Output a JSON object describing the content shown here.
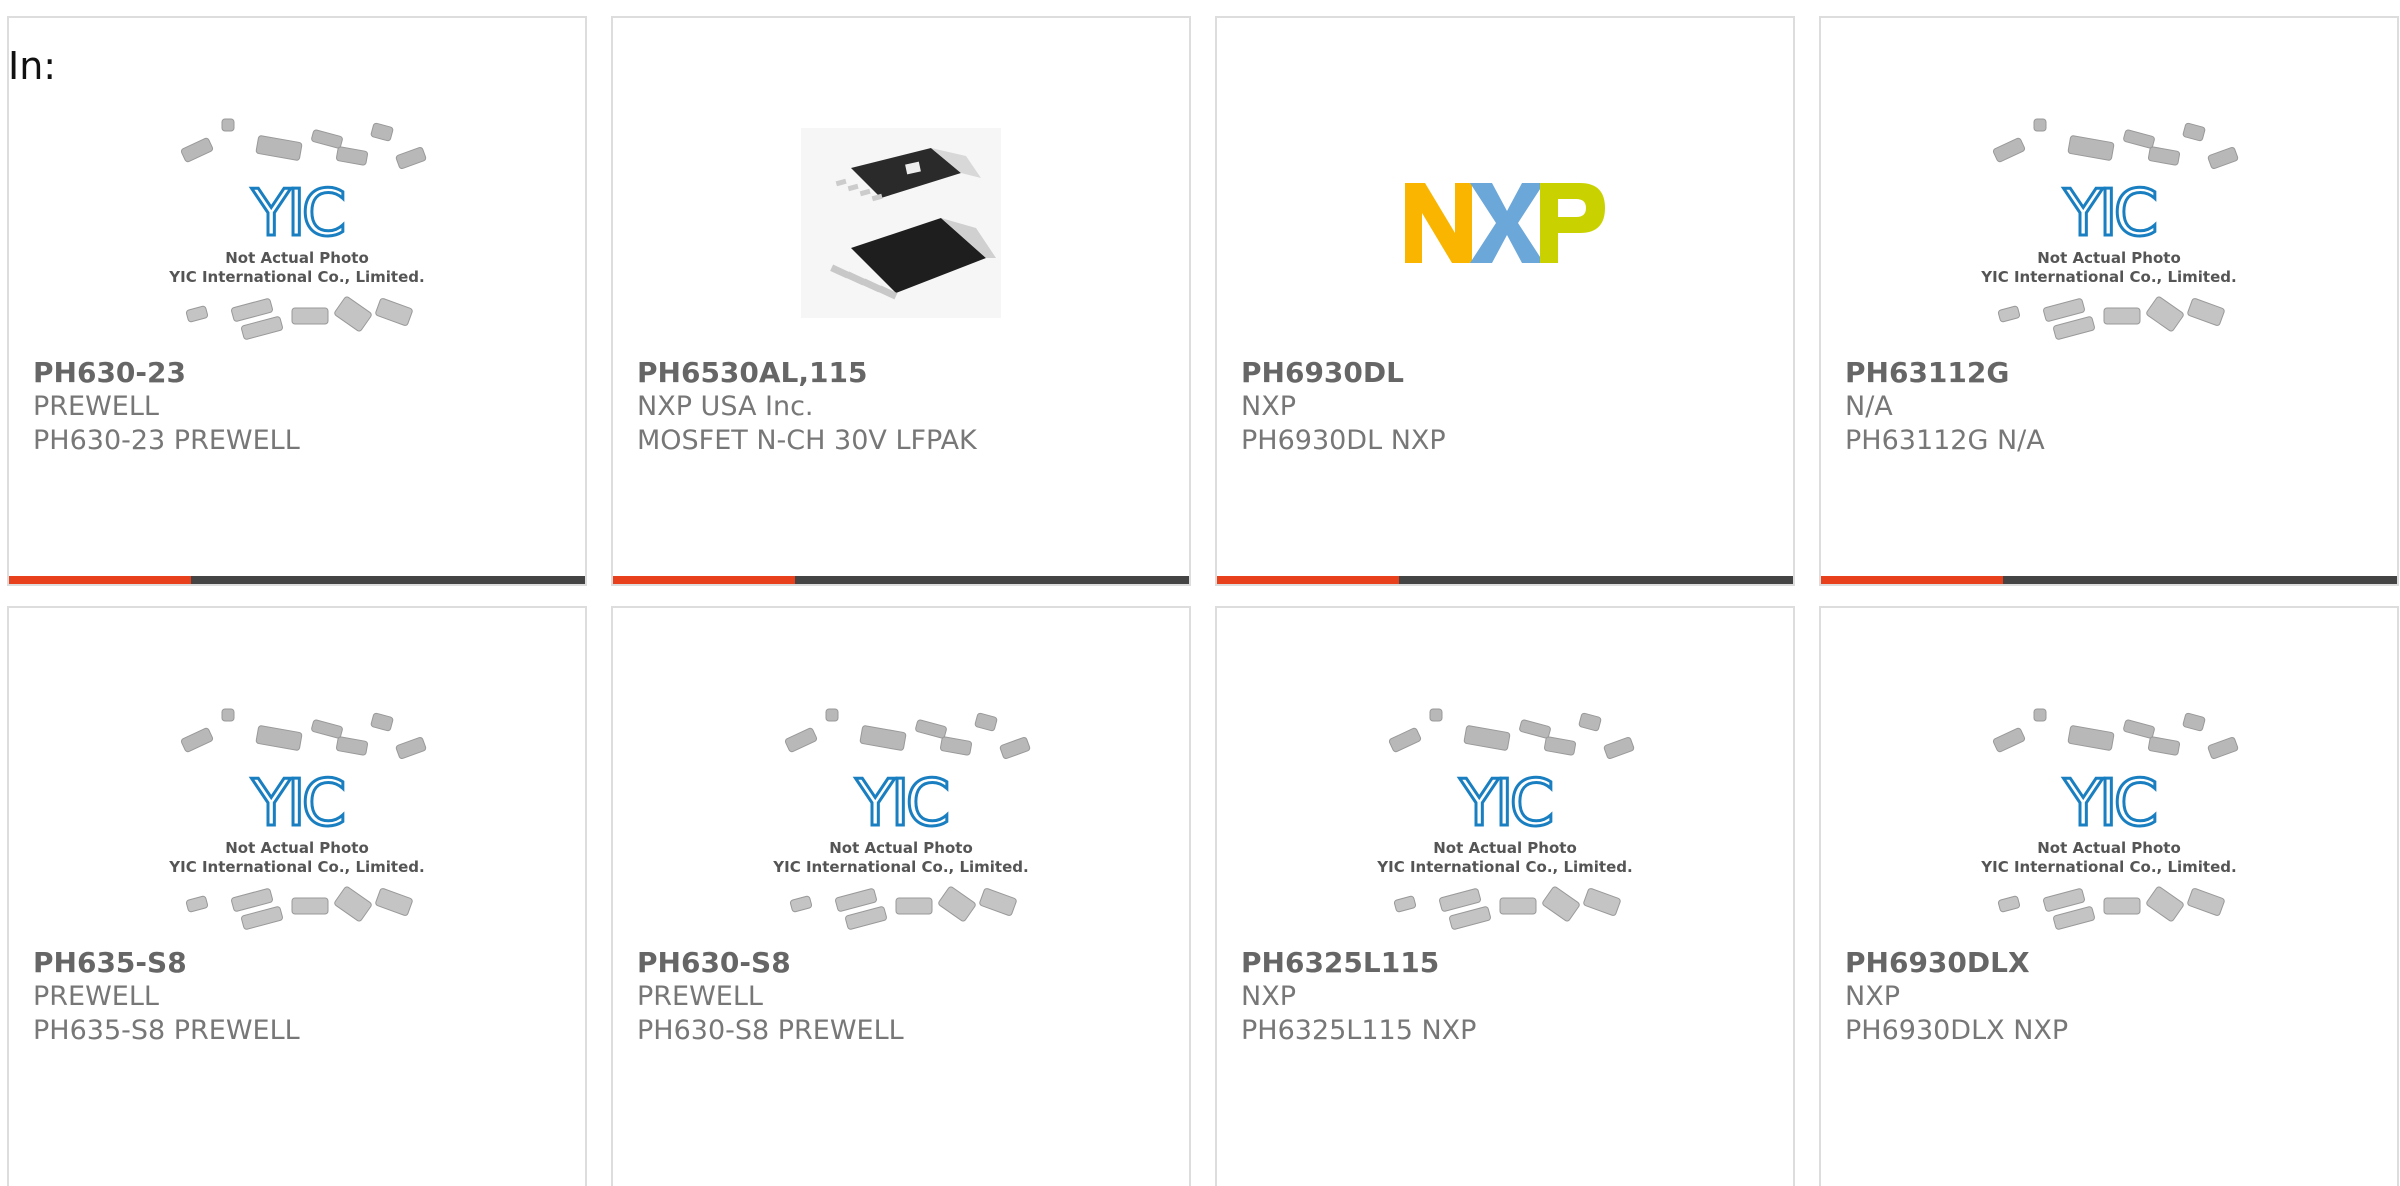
{
  "prefix_label": "In:",
  "placeholder": {
    "caption_line1": "Not Actual Photo",
    "caption_line2": "YIC International Co., Limited.",
    "logo_text": "YIC"
  },
  "nxp_logo": {
    "letters": [
      "N",
      "X",
      "P"
    ],
    "colors": [
      "#f9b500",
      "#6ca7da",
      "#c9d200"
    ]
  },
  "colors": {
    "accent": "#e8401c",
    "bar": "#444444",
    "yic_blue": "#1a7fc1"
  },
  "products": [
    {
      "part": "PH630-23",
      "manufacturer": "PREWELL",
      "description": "PH630-23 PREWELL",
      "image": "yic-placeholder"
    },
    {
      "part": "PH6530AL,115",
      "manufacturer": "NXP USA Inc.",
      "description": "MOSFET N-CH 30V LFPAK",
      "image": "lfpak-chip-photo"
    },
    {
      "part": "PH6930DL",
      "manufacturer": "NXP",
      "description": "PH6930DL NXP",
      "image": "nxp-logo"
    },
    {
      "part": "PH63112G",
      "manufacturer": "N/A",
      "description": "PH63112G N/A",
      "image": "yic-placeholder"
    },
    {
      "part": "PH635-S8",
      "manufacturer": "PREWELL",
      "description": "PH635-S8 PREWELL",
      "image": "yic-placeholder"
    },
    {
      "part": "PH630-S8",
      "manufacturer": "PREWELL",
      "description": "PH630-S8 PREWELL",
      "image": "yic-placeholder"
    },
    {
      "part": "PH6325L115",
      "manufacturer": "NXP",
      "description": "PH6325L115 NXP",
      "image": "yic-placeholder"
    },
    {
      "part": "PH6930DLX",
      "manufacturer": "NXP",
      "description": "PH6930DLX NXP",
      "image": "yic-placeholder"
    }
  ]
}
